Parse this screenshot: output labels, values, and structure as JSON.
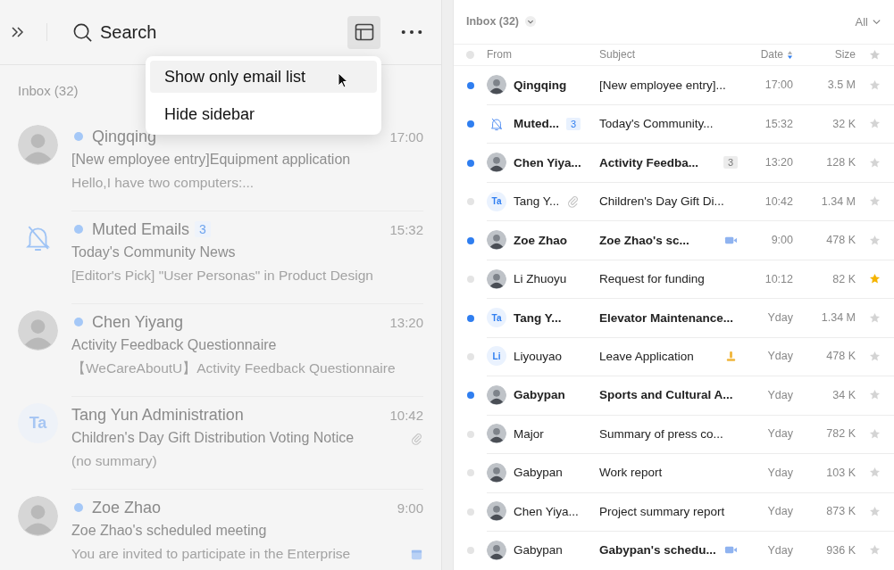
{
  "toolbar": {
    "search": {
      "placeholder": "Search"
    },
    "layout_button": {
      "selected": true
    }
  },
  "menu": {
    "items": [
      {
        "label": "Show only email list",
        "selected": true
      },
      {
        "label": "Hide sidebar",
        "selected": false
      }
    ]
  },
  "sidebar": {
    "title": "Inbox (32)",
    "messages": [
      {
        "avatar": {
          "kind": "photo"
        },
        "sender": "Qingqing",
        "unread": true,
        "time": "17:00",
        "subject": "[New employee entry]Equipment application",
        "preview": "Hello,I have two computers:..."
      },
      {
        "avatar": {
          "kind": "muted"
        },
        "sender": "Muted Emails",
        "unread": true,
        "count": "3",
        "time": "15:32",
        "subject": "Today's Community News",
        "preview": "[Editor's Pick] \"User Personas\" in Product Design"
      },
      {
        "avatar": {
          "kind": "photo"
        },
        "sender": "Chen Yiyang",
        "unread": true,
        "time": "13:20",
        "subject": "Activity Feedback Questionnaire",
        "preview": "【WeCareAboutU】Activity Feedback Questionnaire"
      },
      {
        "avatar": {
          "kind": "initials",
          "text": "Ta"
        },
        "sender": "Tang Yun Administration",
        "unread": false,
        "time": "10:42",
        "subject": "Children's Day Gift Distribution Voting Notice",
        "preview": "(no summary)",
        "attachment": true
      },
      {
        "avatar": {
          "kind": "photo"
        },
        "sender": "Zoe Zhao",
        "unread": true,
        "time": "9:00",
        "subject": "Zoe Zhao's scheduled meeting",
        "preview": "You are invited to participate in the Enterprise",
        "calendar_event": true
      }
    ]
  },
  "list": {
    "title": "Inbox (32)",
    "filter": "All",
    "columns": [
      "From",
      "Subject",
      "Date",
      "Size"
    ],
    "rows": [
      {
        "unread": true,
        "avatar": {
          "kind": "photo"
        },
        "sender": "Qingqing",
        "subject": "[New employee entry]...",
        "subject_bold": false,
        "date": "17:00",
        "size": "3.5 M",
        "starred": false
      },
      {
        "unread": true,
        "avatar": {
          "kind": "muted"
        },
        "sender": "Muted...",
        "sender_count": "3",
        "subject": "Today's Community...",
        "subject_bold": false,
        "date": "15:32",
        "size": "32 K",
        "starred": false
      },
      {
        "unread": true,
        "avatar": {
          "kind": "photo"
        },
        "sender": "Chen Yiya...",
        "subject": "Activity Feedba...",
        "subject_bold": true,
        "subject_count": "3",
        "date": "13:20",
        "size": "128 K",
        "starred": false
      },
      {
        "unread": false,
        "avatar": {
          "kind": "initials",
          "text": "Ta"
        },
        "sender": "Tang Y...",
        "attachment": true,
        "subject": "Children's Day Gift Di...",
        "subject_bold": false,
        "date": "10:42",
        "size": "1.34 M",
        "starred": false
      },
      {
        "unread": true,
        "avatar": {
          "kind": "photo"
        },
        "sender": "Zoe Zhao",
        "subject": "Zoe Zhao's sc...",
        "subject_bold": true,
        "video_meeting": true,
        "date": "9:00",
        "size": "478 K",
        "starred": false
      },
      {
        "unread": false,
        "avatar": {
          "kind": "photo"
        },
        "sender": "Li Zhuoyu",
        "subject": "Request for funding",
        "subject_bold": false,
        "date": "10:12",
        "size": "82 K",
        "starred": true
      },
      {
        "unread": true,
        "avatar": {
          "kind": "initials",
          "text": "Ta"
        },
        "sender": "Tang Y...",
        "subject": "Elevator Maintenance...",
        "subject_bold": true,
        "date": "Yday",
        "size": "1.34 M",
        "starred": false
      },
      {
        "unread": false,
        "avatar": {
          "kind": "initials",
          "text": "Li"
        },
        "sender": "Liyouyao",
        "subject": "Leave Application",
        "subject_bold": false,
        "stamped": true,
        "date": "Yday",
        "size": "478 K",
        "starred": false
      },
      {
        "unread": true,
        "avatar": {
          "kind": "photo"
        },
        "sender": "Gabypan",
        "subject": "Sports and Cultural A...",
        "subject_bold": true,
        "date": "Yday",
        "size": "34 K",
        "starred": false
      },
      {
        "unread": false,
        "avatar": {
          "kind": "photo"
        },
        "sender": "Major",
        "subject": "Summary of press co...",
        "subject_bold": false,
        "date": "Yday",
        "size": "782 K",
        "starred": false
      },
      {
        "unread": false,
        "avatar": {
          "kind": "photo"
        },
        "sender": "Gabypan",
        "subject": "Work report",
        "subject_bold": false,
        "date": "Yday",
        "size": "103 K",
        "starred": false
      },
      {
        "unread": false,
        "avatar": {
          "kind": "photo"
        },
        "sender": "Chen Yiya...",
        "subject": "Project summary report",
        "subject_bold": false,
        "date": "Yday",
        "size": "873 K",
        "starred": false
      },
      {
        "unread": false,
        "avatar": {
          "kind": "photo"
        },
        "sender": "Gabypan",
        "subject": "Gabypan's schedu...",
        "subject_bold": true,
        "video_meeting": true,
        "date": "Yday",
        "size": "936 K",
        "starred": false
      }
    ]
  }
}
